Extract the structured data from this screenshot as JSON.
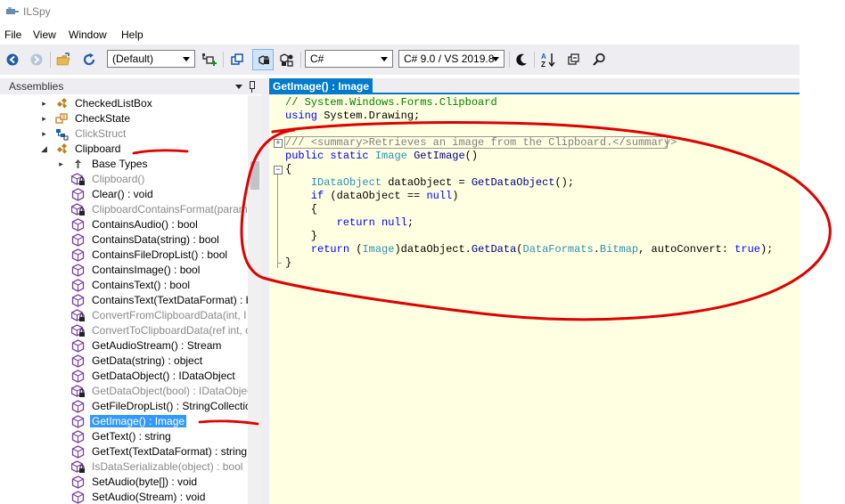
{
  "window": {
    "title": "ILSpy",
    "app_icon": "ilspy-logo-icon"
  },
  "menu": [
    "File",
    "View",
    "Window",
    "Help"
  ],
  "toolbar": {
    "assembly_list": "(Default)",
    "language": "C#",
    "language_version": "C# 9.0 / VS 2019.8",
    "icons": [
      "back-icon",
      "forward-icon",
      "open-folder-icon",
      "refresh-icon",
      "add-assembly-icon",
      "show-derived-icon",
      "show-private-icon",
      "show-all-icon",
      "theme-moon-icon",
      "sort-icon",
      "collapse-icon",
      "search-icon"
    ]
  },
  "assemblies": {
    "header": "Assemblies",
    "items": [
      {
        "label": "CheckedListBox",
        "level": 0,
        "expander": "+",
        "icon": "class-icon",
        "state": "normal"
      },
      {
        "label": "CheckState",
        "level": 0,
        "expander": "+",
        "icon": "enum-icon",
        "state": "normal"
      },
      {
        "label": "ClickStruct",
        "level": 0,
        "expander": "+",
        "icon": "struct-icon",
        "state": "grey"
      },
      {
        "label": "Clipboard",
        "level": 0,
        "expander": "-",
        "icon": "class-icon",
        "state": "normal"
      },
      {
        "label": "Base Types",
        "level": 1,
        "expander": "+",
        "icon": "base-types-icon",
        "state": "normal"
      },
      {
        "label": "Clipboard()",
        "level": 1,
        "expander": "",
        "icon": "method-private-icon",
        "state": "grey"
      },
      {
        "label": "Clear() : void",
        "level": 1,
        "expander": "",
        "icon": "method-icon",
        "state": "normal"
      },
      {
        "label": "ClipboardContainsFormat(param",
        "level": 1,
        "expander": "",
        "icon": "method-private-icon",
        "state": "grey"
      },
      {
        "label": "ContainsAudio() : bool",
        "level": 1,
        "expander": "",
        "icon": "method-icon",
        "state": "normal"
      },
      {
        "label": "ContainsData(string) : bool",
        "level": 1,
        "expander": "",
        "icon": "method-icon",
        "state": "normal"
      },
      {
        "label": "ContainsFileDropList() : bool",
        "level": 1,
        "expander": "",
        "icon": "method-icon",
        "state": "normal"
      },
      {
        "label": "ContainsImage() : bool",
        "level": 1,
        "expander": "",
        "icon": "method-icon",
        "state": "normal"
      },
      {
        "label": "ContainsText() : bool",
        "level": 1,
        "expander": "",
        "icon": "method-icon",
        "state": "normal"
      },
      {
        "label": "ContainsText(TextDataFormat) : b",
        "level": 1,
        "expander": "",
        "icon": "method-icon",
        "state": "normal"
      },
      {
        "label": "ConvertFromClipboardData(int, I",
        "level": 1,
        "expander": "",
        "icon": "method-private-icon",
        "state": "grey"
      },
      {
        "label": "ConvertToClipboardData(ref int, o",
        "level": 1,
        "expander": "",
        "icon": "method-private-icon",
        "state": "grey"
      },
      {
        "label": "GetAudioStream() : Stream",
        "level": 1,
        "expander": "",
        "icon": "method-icon",
        "state": "normal"
      },
      {
        "label": "GetData(string) : object",
        "level": 1,
        "expander": "",
        "icon": "method-icon",
        "state": "normal"
      },
      {
        "label": "GetDataObject() : IDataObject",
        "level": 1,
        "expander": "",
        "icon": "method-icon",
        "state": "normal"
      },
      {
        "label": "GetDataObject(bool) : IDataObjec",
        "level": 1,
        "expander": "",
        "icon": "method-private-icon",
        "state": "grey"
      },
      {
        "label": "GetFileDropList() : StringCollectio",
        "level": 1,
        "expander": "",
        "icon": "method-icon",
        "state": "normal"
      },
      {
        "label": "GetImage() : Image",
        "level": 1,
        "expander": "",
        "icon": "method-icon",
        "state": "selected"
      },
      {
        "label": "GetText() : string",
        "level": 1,
        "expander": "",
        "icon": "method-icon",
        "state": "normal"
      },
      {
        "label": "GetText(TextDataFormat) : string",
        "level": 1,
        "expander": "",
        "icon": "method-icon",
        "state": "normal"
      },
      {
        "label": "IsDataSerializable(object) : bool",
        "level": 1,
        "expander": "",
        "icon": "method-private-icon",
        "state": "grey"
      },
      {
        "label": "SetAudio(byte[]) : void",
        "level": 1,
        "expander": "",
        "icon": "method-icon",
        "state": "normal"
      },
      {
        "label": "SetAudio(Stream) : void",
        "level": 1,
        "expander": "",
        "icon": "method-icon",
        "state": "normal"
      }
    ]
  },
  "editor": {
    "tab_title": "GetImage() : Image",
    "lines": [
      [
        {
          "t": "// System.Windows.Forms.Clipboard",
          "c": "cmt"
        }
      ],
      [
        {
          "t": "using",
          "c": "kw"
        },
        {
          "t": " System.Drawing;",
          "c": ""
        }
      ],
      [
        {
          "t": "",
          "c": ""
        }
      ],
      [
        {
          "t": "/// ",
          "c": "doc"
        },
        {
          "t": "<summary>Retrieves an image from the Clipboard.</summary>",
          "c": "doc"
        }
      ],
      [
        {
          "t": "public",
          "c": "kw"
        },
        {
          "t": " ",
          "c": ""
        },
        {
          "t": "static",
          "c": "kw"
        },
        {
          "t": " ",
          "c": ""
        },
        {
          "t": "Image",
          "c": "typ"
        },
        {
          "t": " ",
          "c": ""
        },
        {
          "t": "GetImage",
          "c": "mtd"
        },
        {
          "t": "()",
          "c": ""
        }
      ],
      [
        {
          "t": "{",
          "c": ""
        }
      ],
      [
        {
          "t": "    ",
          "c": ""
        },
        {
          "t": "IDataObject",
          "c": "typ"
        },
        {
          "t": " dataObject = ",
          "c": ""
        },
        {
          "t": "GetDataObject",
          "c": "mtd"
        },
        {
          "t": "();",
          "c": ""
        }
      ],
      [
        {
          "t": "    ",
          "c": ""
        },
        {
          "t": "if",
          "c": "kw"
        },
        {
          "t": " (dataObject == ",
          "c": ""
        },
        {
          "t": "null",
          "c": "kw"
        },
        {
          "t": ")",
          "c": ""
        }
      ],
      [
        {
          "t": "    {",
          "c": ""
        }
      ],
      [
        {
          "t": "        ",
          "c": ""
        },
        {
          "t": "return",
          "c": "kw"
        },
        {
          "t": " ",
          "c": ""
        },
        {
          "t": "null",
          "c": "kw"
        },
        {
          "t": ";",
          "c": ""
        }
      ],
      [
        {
          "t": "    }",
          "c": ""
        }
      ],
      [
        {
          "t": "    ",
          "c": ""
        },
        {
          "t": "return",
          "c": "kw"
        },
        {
          "t": " (",
          "c": ""
        },
        {
          "t": "Image",
          "c": "typ"
        },
        {
          "t": ")dataObject.",
          "c": ""
        },
        {
          "t": "GetData",
          "c": "mtd"
        },
        {
          "t": "(",
          "c": ""
        },
        {
          "t": "DataFormats",
          "c": "typ"
        },
        {
          "t": ".",
          "c": ""
        },
        {
          "t": "Bitmap",
          "c": "typ"
        },
        {
          "t": ", autoConvert: ",
          "c": ""
        },
        {
          "t": "true",
          "c": "kw"
        },
        {
          "t": ");",
          "c": ""
        }
      ],
      [
        {
          "t": "}",
          "c": ""
        }
      ]
    ]
  },
  "colors": {
    "accent": "#007acc",
    "selection": "#3399ff",
    "editor_bg": "#ffffe2",
    "annotation": "#e00000"
  }
}
